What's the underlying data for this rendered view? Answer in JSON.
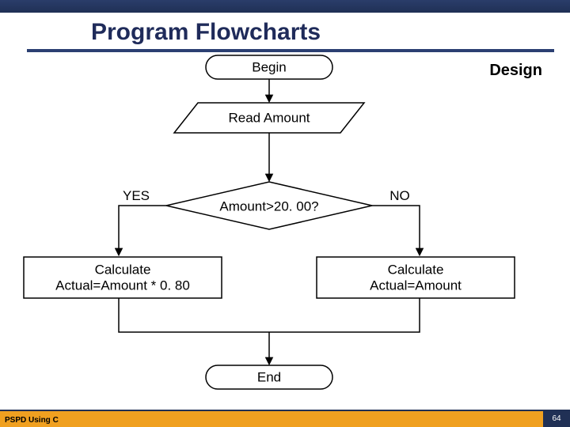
{
  "header": {
    "title": "Program Flowcharts",
    "corner_label": "Design"
  },
  "flow": {
    "begin": "Begin",
    "read": "Read Amount",
    "decision": "Amount>20. 00?",
    "yes": "YES",
    "no": "NO",
    "calc_yes_l1": "Calculate",
    "calc_yes_l2": "Actual=Amount * 0. 80",
    "calc_no_l1": "Calculate",
    "calc_no_l2": "Actual=Amount",
    "end": "End"
  },
  "footer": {
    "left": "PSPD Using C",
    "page": "64"
  }
}
